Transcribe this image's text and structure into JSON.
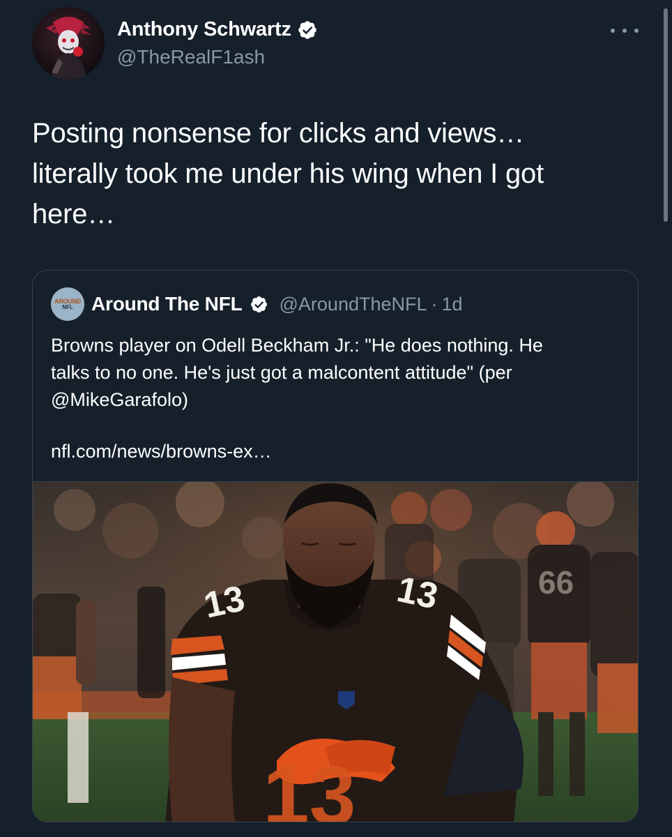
{
  "tweet": {
    "author": {
      "name": "Anthony Schwartz",
      "handle": "@TheRealF1ash",
      "verified": true,
      "avatar_icon": "character-avatar"
    },
    "more_icon": "more-dots-icon",
    "text_lines": [
      "Posting nonsense for clicks and views…",
      "literally took me under his wing when I got",
      "here…"
    ]
  },
  "quoted_tweet": {
    "author": {
      "name": "Around The NFL",
      "handle": "@AroundTheNFL",
      "separator": "·",
      "time": "1d",
      "verified": true,
      "avatar_text_top": "AROUND",
      "avatar_text_bottom": "NFL"
    },
    "text_lines": [
      "Browns player on Odell Beckham Jr.: \"He does nothing. He",
      "talks to no one. He's just got a malcontent attitude\" (per",
      "@MikeGarafolo)"
    ],
    "link_text": "nfl.com/news/browns-ex…",
    "image": {
      "description_icon": "football-player-photo",
      "jersey_number": "13"
    }
  },
  "colors": {
    "background": "#15202b",
    "primary_text": "#ffffff",
    "secondary_text": "#8b98a5",
    "border": "#38444d",
    "verified_badge": "#ffffff"
  }
}
